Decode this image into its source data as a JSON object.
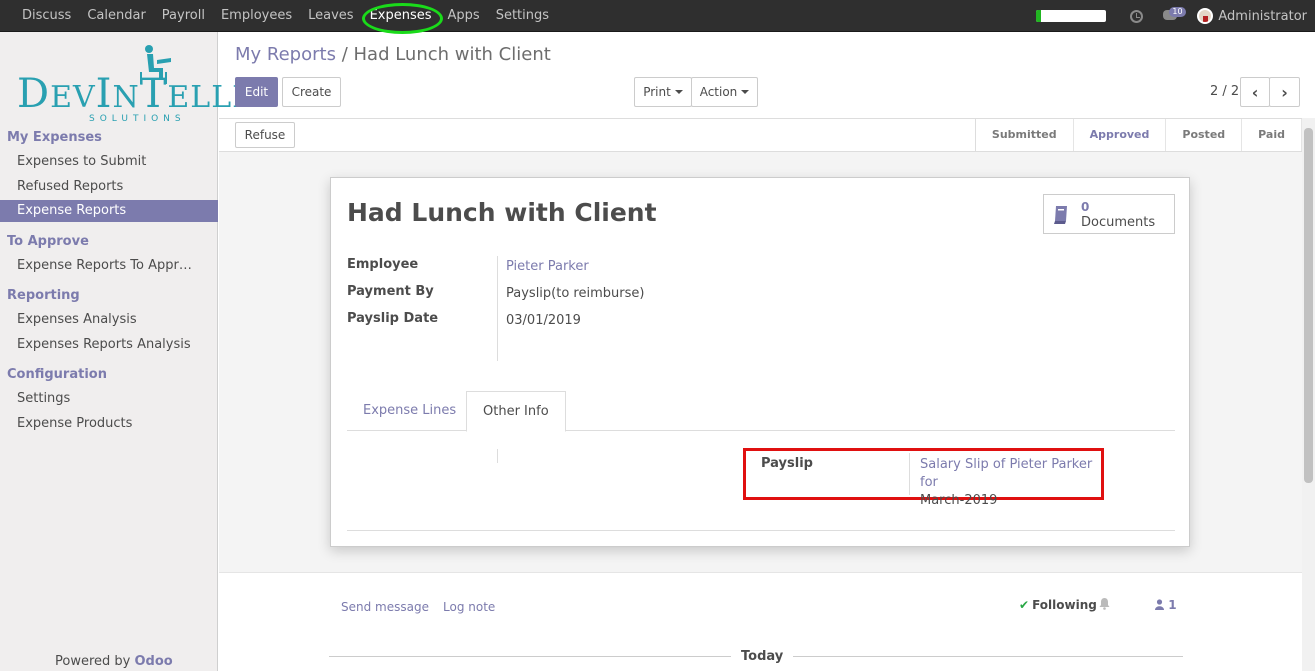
{
  "topbar": {
    "menu": [
      "Discuss",
      "Calendar",
      "Payroll",
      "Employees",
      "Leaves",
      "Expenses",
      "Apps",
      "Settings"
    ],
    "active_menu": "Expenses",
    "chat_count": "10",
    "user": "Administrator",
    "progress_fraction": 0.06
  },
  "logo": {
    "word": "DevIntelle",
    "sub": "SOLUTIONS"
  },
  "sidebar": {
    "sections": [
      {
        "title": "My Expenses",
        "items": [
          "Expenses to Submit",
          "Refused Reports",
          "Expense Reports"
        ]
      },
      {
        "title": "To Approve",
        "items": [
          "Expense Reports To Appr…"
        ]
      },
      {
        "title": "Reporting",
        "items": [
          "Expenses Analysis",
          "Expenses Reports Analysis"
        ]
      },
      {
        "title": "Configuration",
        "items": [
          "Settings",
          "Expense Products"
        ]
      }
    ],
    "selected": "Expense Reports",
    "powered_prefix": "Powered by",
    "powered_brand": "Odoo"
  },
  "breadcrumb": {
    "parent": "My Reports",
    "separator": "/",
    "current": "Had Lunch with Client"
  },
  "buttons": {
    "edit": "Edit",
    "create": "Create",
    "print": "Print",
    "action": "Action",
    "refuse": "Refuse"
  },
  "pager": {
    "value": "2 / 2"
  },
  "stages": [
    "Submitted",
    "Approved",
    "Posted",
    "Paid"
  ],
  "current_stage": "Approved",
  "record": {
    "title": "Had Lunch with Client",
    "documents": {
      "count": "0",
      "label": "Documents"
    },
    "fields": {
      "employee_label": "Employee",
      "employee": "Pieter Parker",
      "payment_label": "Payment By",
      "payment": "Payslip(to reimburse)",
      "date_label": "Payslip Date",
      "date": "03/01/2019"
    },
    "tabs": [
      "Expense Lines",
      "Other Info"
    ],
    "active_tab": "Other Info",
    "payslip_label": "Payslip",
    "payslip_link": "Salary Slip of Pieter Parker for",
    "payslip_rest": "March-2019"
  },
  "chatter": {
    "send_message": "Send message",
    "log_note": "Log note",
    "following": "Following",
    "followers": "1",
    "today": "Today"
  },
  "colors": {
    "accent": "#7c7bad",
    "topbar": "#2f2f2f",
    "highlight": "#e01010",
    "menu_circle": "#1adb1a"
  }
}
